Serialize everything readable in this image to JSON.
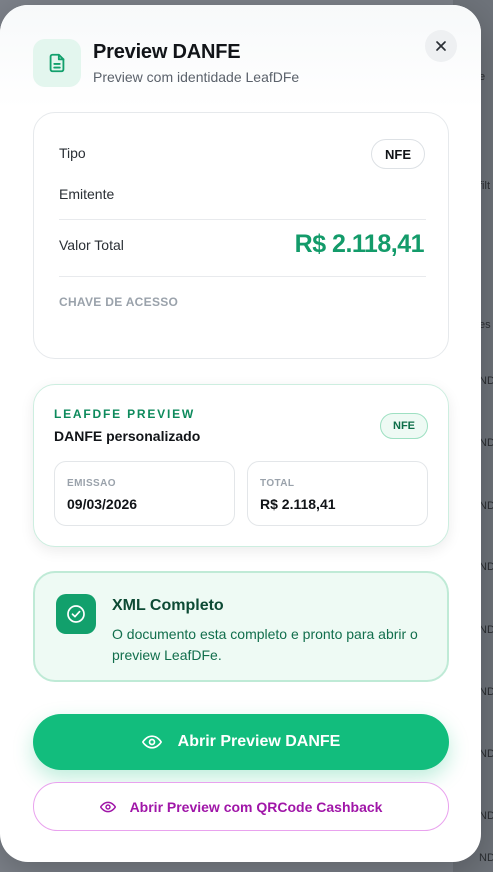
{
  "background": {
    "fragments": [
      "e",
      "filt",
      "es",
      "ND",
      "ND",
      "ND",
      "ND",
      "ND",
      "ND",
      "ND",
      "ND",
      "ND",
      "ND"
    ]
  },
  "modal": {
    "title": "Preview DANFE",
    "subtitle": "Preview com identidade LeafDFe",
    "close_icon": "close-icon",
    "doc_icon": "document-icon"
  },
  "details": {
    "tipo_label": "Tipo",
    "tipo_value": "NFE",
    "emitente_label": "Emitente",
    "valor_label": "Valor Total",
    "valor_value": "R$ 2.118,41",
    "chave_label": "CHAVE DE ACESSO"
  },
  "preview": {
    "brand": "LEAFDFE PREVIEW",
    "title": "DANFE personalizado",
    "badge": "NFE",
    "emissao_label": "EMISSAO",
    "emissao_value": "09/03/2026",
    "total_label": "TOTAL",
    "total_value": "R$ 2.118,41"
  },
  "status": {
    "title": "XML Completo",
    "description": "O documento esta completo e pronto para abrir o preview LeafDFe.",
    "icon": "check-circle-icon"
  },
  "actions": {
    "primary_label": "Abrir Preview DANFE",
    "secondary_label": "Abrir Preview com QRCode Cashback",
    "icon": "eye-icon"
  },
  "colors": {
    "accent": "#12bd7d",
    "amount": "#139b6a",
    "secondary": "#a016a8"
  }
}
